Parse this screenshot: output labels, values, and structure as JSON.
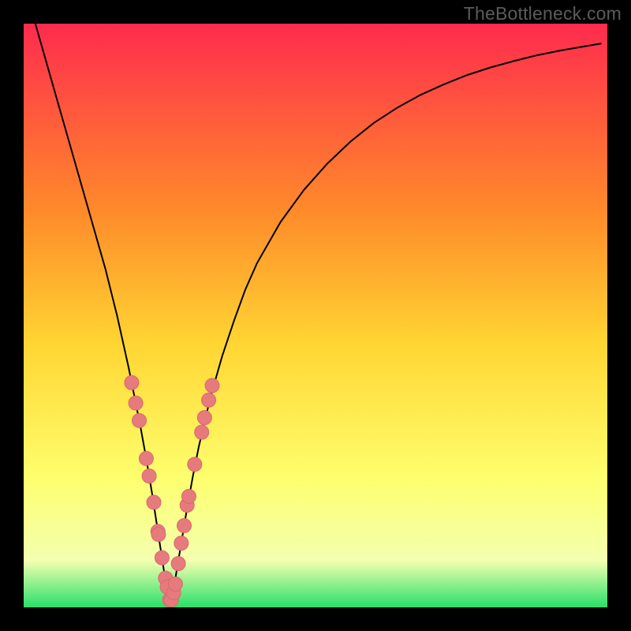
{
  "watermark": "TheBottleneck.com",
  "colors": {
    "bg_black": "#000000",
    "gradient_top": "#ff2b4e",
    "gradient_mid1": "#ff8a2a",
    "gradient_mid2": "#ffd633",
    "gradient_mid3": "#feff6e",
    "gradient_mid4": "#f4ffb0",
    "gradient_bottom": "#29e06b",
    "curve": "#000000",
    "marker_fill": "#e77a7d",
    "marker_stroke": "#d86a6e"
  },
  "chart_data": {
    "type": "line",
    "title": "",
    "xlabel": "",
    "ylabel": "",
    "x_range": [
      0,
      100
    ],
    "y_range": [
      0,
      100
    ],
    "optimum_x": 25,
    "series": [
      {
        "name": "bottleneck-curve",
        "x": [
          2,
          4,
          6,
          8,
          10,
          12,
          14,
          16,
          18,
          19,
          20,
          21,
          22,
          23,
          24,
          25,
          26,
          27,
          28,
          29,
          30,
          32,
          34,
          36,
          38,
          40,
          44,
          48,
          52,
          56,
          60,
          64,
          68,
          72,
          76,
          80,
          84,
          88,
          92,
          96,
          99
        ],
        "y": [
          100,
          93,
          86,
          79,
          72,
          65,
          58,
          50,
          41,
          36,
          31,
          25.5,
          19.5,
          13,
          6.5,
          1.2,
          5,
          11,
          17,
          22.5,
          27.5,
          36,
          43,
          49,
          54.5,
          59,
          66,
          71.5,
          76,
          79.8,
          83,
          85.6,
          87.8,
          89.6,
          91.2,
          92.5,
          93.6,
          94.6,
          95.4,
          96.1,
          96.6
        ]
      }
    ],
    "markers": {
      "name": "sample-points",
      "points": [
        {
          "x": 18.5,
          "y": 38.5
        },
        {
          "x": 19.2,
          "y": 35.0
        },
        {
          "x": 19.8,
          "y": 32.0
        },
        {
          "x": 21.0,
          "y": 25.5
        },
        {
          "x": 21.5,
          "y": 22.5
        },
        {
          "x": 22.3,
          "y": 18.0
        },
        {
          "x": 23.0,
          "y": 13.0
        },
        {
          "x": 23.1,
          "y": 12.5
        },
        {
          "x": 23.7,
          "y": 8.5
        },
        {
          "x": 24.3,
          "y": 5.0
        },
        {
          "x": 24.6,
          "y": 3.5
        },
        {
          "x": 25.0,
          "y": 1.3
        },
        {
          "x": 25.3,
          "y": 1.3
        },
        {
          "x": 25.7,
          "y": 2.5
        },
        {
          "x": 26.0,
          "y": 4.0
        },
        {
          "x": 26.5,
          "y": 7.5
        },
        {
          "x": 27.0,
          "y": 11.0
        },
        {
          "x": 27.5,
          "y": 14.0
        },
        {
          "x": 28.0,
          "y": 17.5
        },
        {
          "x": 28.3,
          "y": 19.0
        },
        {
          "x": 29.3,
          "y": 24.5
        },
        {
          "x": 30.5,
          "y": 30.0
        },
        {
          "x": 31.0,
          "y": 32.5
        },
        {
          "x": 31.7,
          "y": 35.5
        },
        {
          "x": 32.3,
          "y": 38.0
        }
      ]
    }
  }
}
